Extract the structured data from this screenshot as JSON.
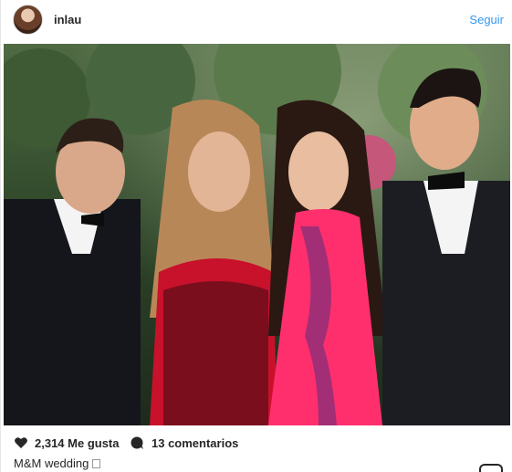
{
  "post": {
    "username": "inlau",
    "follow_label": "Seguir",
    "likes": "2,314 Me gusta",
    "comments": "13 comentarios",
    "caption": "M&M wedding",
    "icons": {
      "avatar": "profile-avatar",
      "photo_badge": "user-tag-icon",
      "like": "heart-icon",
      "comment": "comment-bubble-icon",
      "instagram": "instagram-logo-icon"
    },
    "colors": {
      "link": "#3897f0",
      "text": "#262626"
    }
  }
}
